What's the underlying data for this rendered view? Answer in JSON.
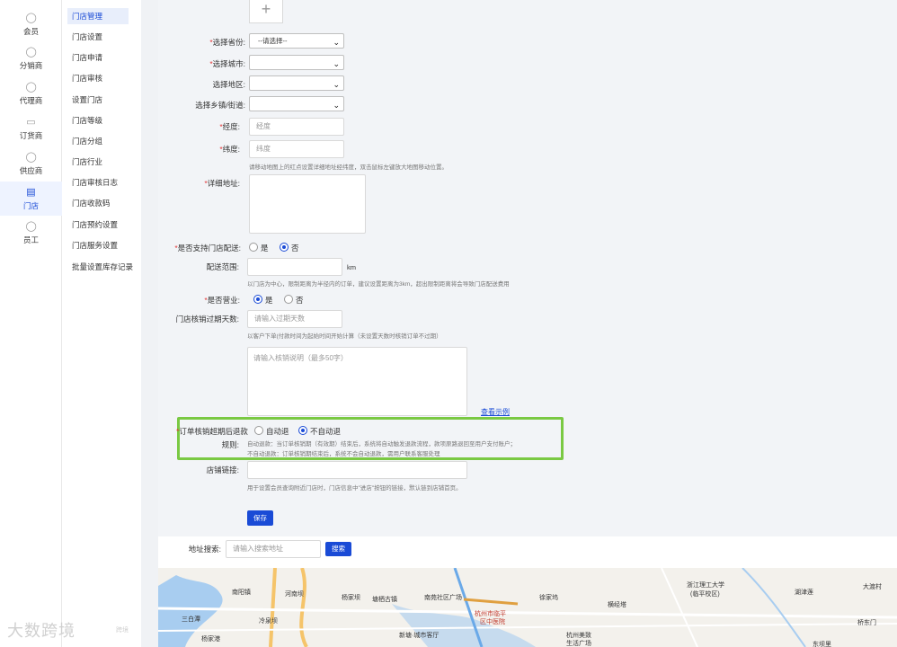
{
  "rail": {
    "items": [
      {
        "label": "会员",
        "icon": "user-icon",
        "active": false
      },
      {
        "label": "分销商",
        "icon": "distributor-icon",
        "active": false
      },
      {
        "label": "代理商",
        "icon": "agent-icon",
        "active": false
      },
      {
        "label": "订货商",
        "icon": "order-icon",
        "active": false
      },
      {
        "label": "供应商",
        "icon": "supplier-icon",
        "active": false
      },
      {
        "label": "门店",
        "icon": "store-icon",
        "active": true
      },
      {
        "label": "员工",
        "icon": "staff-icon",
        "active": false
      }
    ]
  },
  "subnav": {
    "items": [
      {
        "label": "门店管理",
        "active": true
      },
      {
        "label": "门店设置",
        "active": false
      },
      {
        "label": "门店申请",
        "active": false
      },
      {
        "label": "门店审核",
        "active": false
      },
      {
        "label": "设置门店",
        "active": false
      },
      {
        "label": "门店等级",
        "active": false
      },
      {
        "label": "门店分组",
        "active": false
      },
      {
        "label": "门店行业",
        "active": false
      },
      {
        "label": "门店审核日志",
        "active": false
      },
      {
        "label": "门店收款码",
        "active": false
      },
      {
        "label": "门店预约设置",
        "active": false
      },
      {
        "label": "门店服务设置",
        "active": false
      },
      {
        "label": "批量设置库存记录",
        "active": false
      }
    ]
  },
  "form": {
    "upload_plus": "+",
    "province": {
      "label": "选择省份:",
      "value": "--请选择--"
    },
    "city": {
      "label": "选择城市:",
      "value": ""
    },
    "district": {
      "label": "选择地区:",
      "value": ""
    },
    "town": {
      "label": "选择乡镇/街道:",
      "value": ""
    },
    "longitude": {
      "label": "经度:",
      "placeholder": "经度"
    },
    "latitude": {
      "label": "纬度:",
      "placeholder": "纬度"
    },
    "map_hint": "请移动地图上的红点设置详细地址经纬度，双击鼠标左键放大地图移动位置。",
    "address": {
      "label": "详细地址:"
    },
    "delivery_support": {
      "label": "是否支持门店配送:",
      "yes": "是",
      "no": "否",
      "selected": "否"
    },
    "delivery_range": {
      "label": "配送范围:",
      "unit": "km",
      "hint": "以门店为中心，限制距离为半径内的订单，建议设置距离为3km，超出限制距离将会导致门店配送费用"
    },
    "open": {
      "label": "是否营业:",
      "yes": "是",
      "no": "否",
      "selected": "是"
    },
    "expire_days": {
      "label": "门店核销过期天数:",
      "placeholder": "请输入过期天数",
      "hint": "以客户下单(付款时间为起始时间开始计算（未设置天数时核销订单不过期）"
    },
    "verify_desc": {
      "placeholder": "请输入核销说明（最多50字）",
      "example_link": "查看示例"
    },
    "refund_rule": {
      "label_line1": "订单核销超期后退款",
      "label_line2": "规则:",
      "auto": "自动退",
      "no_auto": "不自动退",
      "selected": "不自动退",
      "hint1": "自动退款：当订单核销期（有效期）结束后，系统将自动触发退款流程，款项原路退回至用户支付账户；",
      "hint2": "不自动退款：订单核销期结束后，系统不会自动退款，需用户联系客服处理"
    },
    "store_link": {
      "label": "店铺链接:",
      "hint": "用于设置会员查询附近门店时，门店信息中\"进店\"按钮的链接，默认链到店铺首页。"
    },
    "save_label": "保存"
  },
  "address_search": {
    "label": "地址搜索:",
    "placeholder": "请输入搜索地址",
    "button": "搜索"
  },
  "map": {
    "labels": [
      "南阳镇",
      "河南坝",
      "杨家坝",
      "塘栖古镇",
      "南苑社区广场",
      "浙江理工大学",
      "(临平校区)",
      "湖津莲",
      "大渡村",
      "三白潭",
      "冷泉坝",
      "杭州市临平",
      "区中医院",
      "徐家坞",
      "横经塔",
      "杨家港",
      "新塘·城市客厅",
      "杭州美致",
      "生活广场",
      "桥东门",
      "东坝里"
    ]
  },
  "watermark": {
    "text": "大数跨境",
    "small": "跨境"
  },
  "colors": {
    "primary": "#1a4bd6",
    "highlight_border": "#7ac943",
    "required": "#e23b3b"
  }
}
